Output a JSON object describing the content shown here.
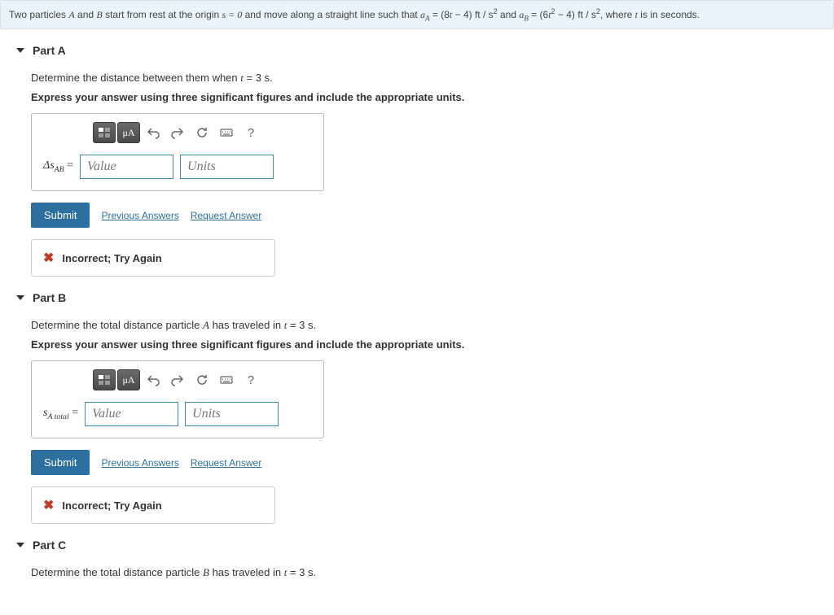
{
  "problem": {
    "prefix": "Two particles ",
    "A": "A",
    "and": " and ",
    "B": "B",
    "mid1": " start from rest at the origin ",
    "s_eq": "s = 0",
    "mid2": " and move along a straight line such that ",
    "aA_lhs": "a",
    "aA_sub": "A",
    "aA_eq": " = (8",
    "t1": "t",
    "aA_rhs": " − 4)  ft / s",
    "sq1": "2",
    "and2": " and ",
    "aB_lhs": "a",
    "aB_sub": "B",
    "aB_eq": " = (6",
    "t2": "t",
    "sq2": "2",
    "aB_rhs": " − 4)  ft / s",
    "sq3": "2",
    "tail": ", where ",
    "t3": "t",
    "tail2": " is in seconds."
  },
  "partA": {
    "title": "Part A",
    "question_pre": "Determine the distance between them when ",
    "question_t": "t",
    "question_post": " = 3 s.",
    "instruction": "Express your answer using three significant figures and include the appropriate units.",
    "var_html": "Δs",
    "var_sub": "AB",
    "value_ph": "Value",
    "units_ph": "Units",
    "mu": "μA",
    "qmark": "?",
    "submit": "Submit",
    "prev": "Previous Answers",
    "req": "Request Answer",
    "feedback": "Incorrect; Try Again"
  },
  "partB": {
    "title": "Part B",
    "question_pre": "Determine the total distance particle ",
    "question_A": "A",
    "question_mid": " has traveled in ",
    "question_t": "t",
    "question_post": " = 3 s.",
    "instruction": "Express your answer using three significant figures and include the appropriate units.",
    "var_html": "s",
    "var_sub": "A total",
    "value_ph": "Value",
    "units_ph": "Units",
    "mu": "μA",
    "qmark": "?",
    "submit": "Submit",
    "prev": "Previous Answers",
    "req": "Request Answer",
    "feedback": "Incorrect; Try Again"
  },
  "partC": {
    "title": "Part C",
    "question_pre": "Determine the total distance particle ",
    "question_B": "B",
    "question_mid": " has traveled in ",
    "question_t": "t",
    "question_post": " = 3 s."
  }
}
